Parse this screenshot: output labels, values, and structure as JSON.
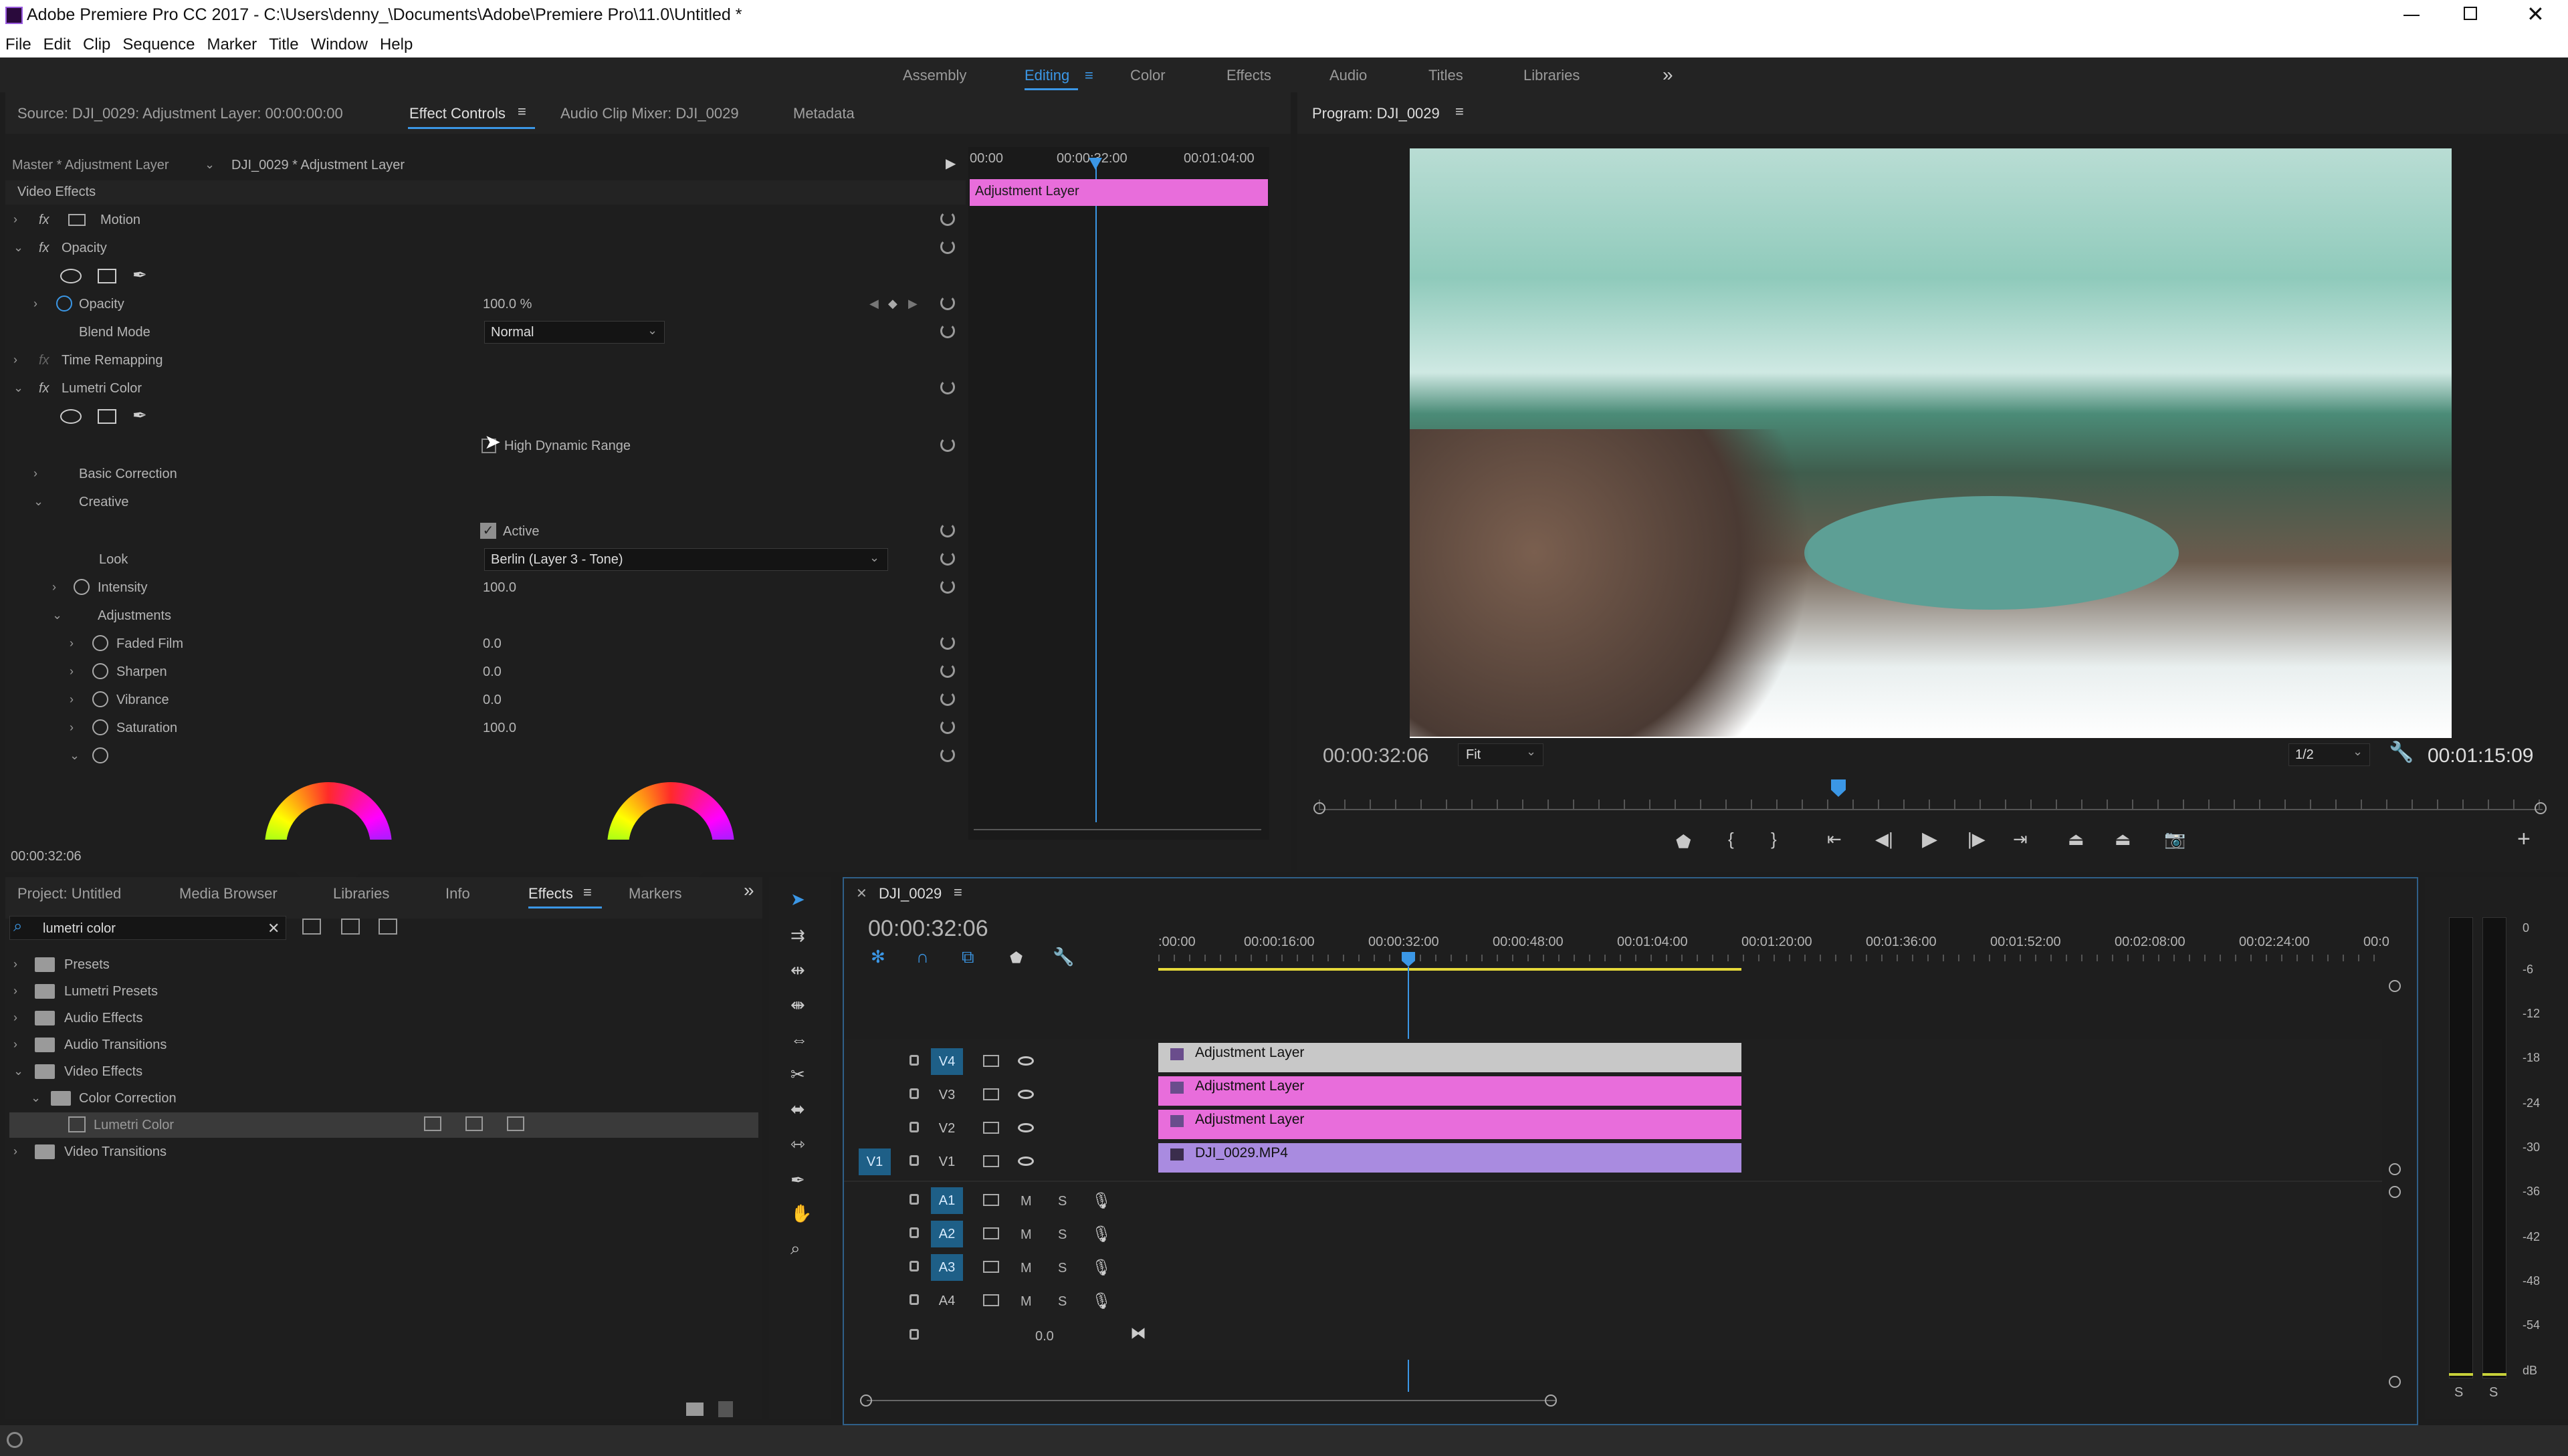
{
  "window": {
    "title": "Adobe Premiere Pro CC 2017 - C:\\Users\\denny_\\Documents\\Adobe\\Premiere Pro\\11.0\\Untitled *"
  },
  "menu": [
    "File",
    "Edit",
    "Clip",
    "Sequence",
    "Marker",
    "Title",
    "Window",
    "Help"
  ],
  "workspaces": [
    "Assembly",
    "Editing",
    "Color",
    "Effects",
    "Audio",
    "Titles",
    "Libraries"
  ],
  "workspace_active": "Editing",
  "source_panel": {
    "tabs": [
      "Source: DJI_0029: Adjustment Layer: 00:00:00:00",
      "Effect Controls",
      "Audio Clip Mixer: DJI_0029",
      "Metadata"
    ],
    "master_label": "Master * Adjustment Layer",
    "clip_label": "DJI_0029 * Adjustment Layer",
    "ruler": [
      "00:00",
      "00:00:32:00",
      "00:01:04:00"
    ],
    "clip_bar": "Adjustment Layer",
    "section": "Video Effects",
    "motion": "Motion",
    "opacity_group": "Opacity",
    "opacity_label": "Opacity",
    "opacity_value": "100.0 %",
    "blend_label": "Blend Mode",
    "blend_value": "Normal",
    "time_remap": "Time Remapping",
    "lumetri": "Lumetri Color",
    "hdr": "High Dynamic Range",
    "basic": "Basic Correction",
    "creative": "Creative",
    "active": "Active",
    "look_label": "Look",
    "look_value": "Berlin (Layer 3 - Tone)",
    "intensity_label": "Intensity",
    "intensity_value": "100.0",
    "adjustments": "Adjustments",
    "faded_label": "Faded Film",
    "faded_value": "0.0",
    "sharpen_label": "Sharpen",
    "sharpen_value": "0.0",
    "vibrance_label": "Vibrance",
    "vibrance_value": "0.0",
    "saturation_label": "Saturation",
    "saturation_value": "100.0",
    "timecode": "00:00:32:06"
  },
  "program": {
    "title": "Program: DJI_0029",
    "timecode": "00:00:32:06",
    "fit": "Fit",
    "quality": "1/2",
    "duration": "00:01:15:09"
  },
  "project_panel": {
    "tabs": [
      "Project: Untitled",
      "Media Browser",
      "Libraries",
      "Info",
      "Effects",
      "Markers"
    ],
    "active_tab": "Effects",
    "search": "lumetri color",
    "tree": [
      "Presets",
      "Lumetri Presets",
      "Audio Effects",
      "Audio Transitions",
      "Video Effects",
      "Color Correction",
      "Lumetri Color",
      "Video Transitions"
    ]
  },
  "timeline": {
    "sequence": "DJI_0029",
    "timecode": "00:00:32:06",
    "ruler": [
      ":00:00",
      "00:00:16:00",
      "00:00:32:00",
      "00:00:48:00",
      "00:01:04:00",
      "00:01:20:00",
      "00:01:36:00",
      "00:01:52:00",
      "00:02:08:00",
      "00:02:24:00",
      "00:0"
    ],
    "video_tracks": [
      "V4",
      "V3",
      "V2",
      "V1"
    ],
    "audio_tracks": [
      "A1",
      "A2",
      "A3",
      "A4"
    ],
    "source_patch": "V1",
    "master_vol": "0.0",
    "clips": [
      "Adjustment Layer",
      "Adjustment Layer",
      "Adjustment Layer",
      "DJI_0029.MP4"
    ],
    "track_m": "M",
    "track_s": "S"
  },
  "meter": {
    "ticks": [
      "0",
      "-6",
      "-12",
      "-18",
      "-24",
      "-30",
      "-36",
      "-42",
      "-48",
      "-54",
      "dB"
    ],
    "solo": [
      "S",
      "S"
    ]
  },
  "colors": {
    "accent": "#3b97e6",
    "pink_clip": "#e86ddb",
    "v4_clip": "#c8c8c8",
    "v1_clip": "#a98be0"
  }
}
